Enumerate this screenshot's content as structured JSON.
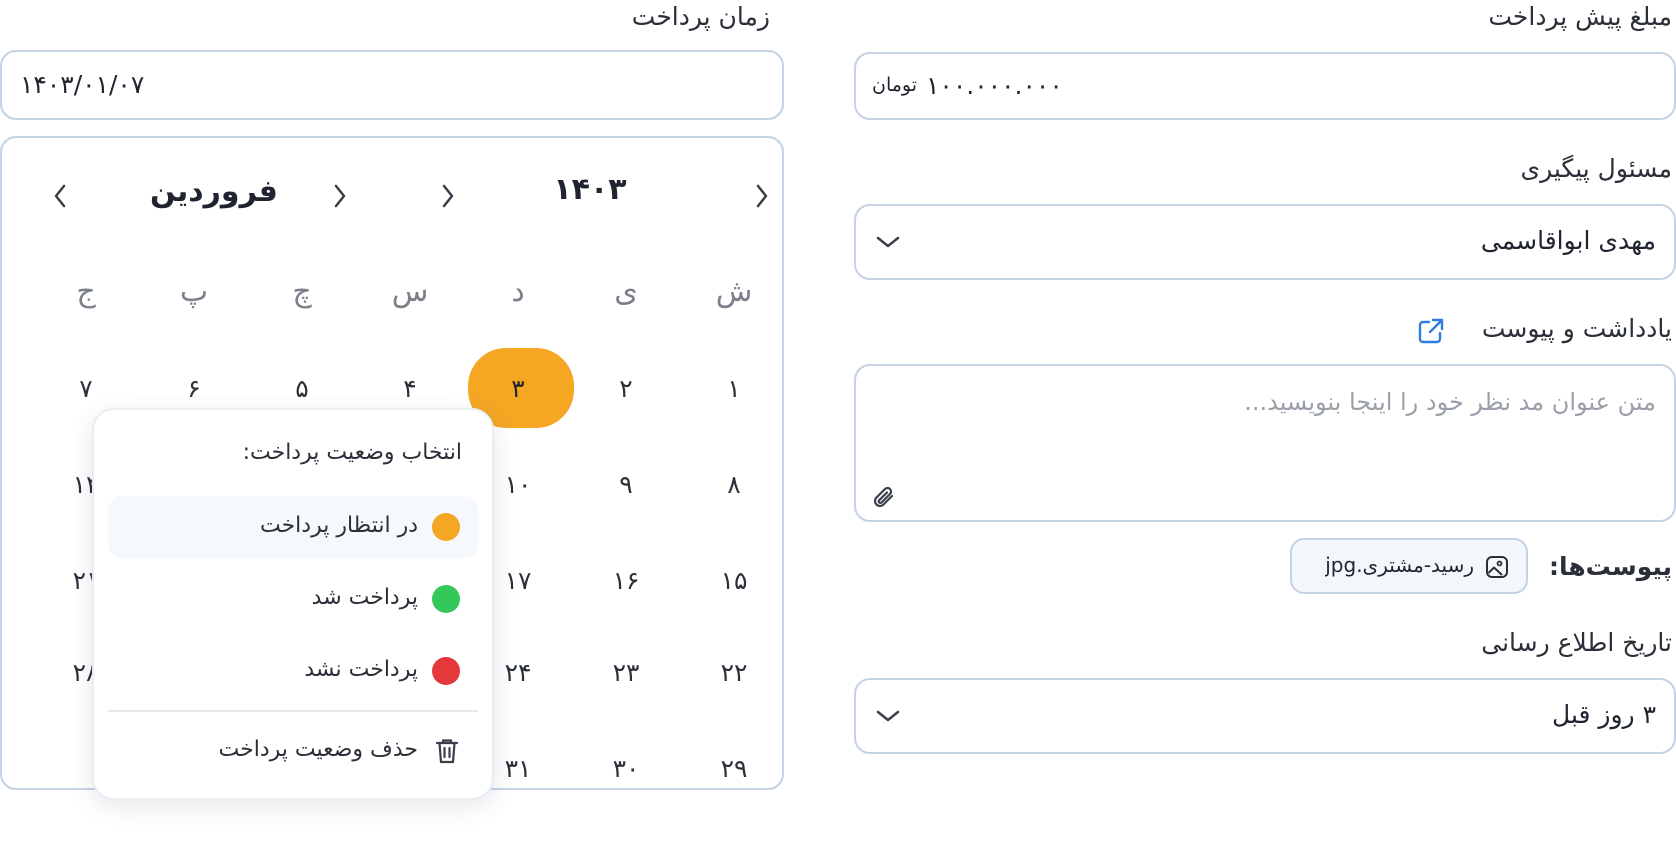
{
  "payment_time": {
    "label": "زمان پرداخت",
    "value": "۱۴۰۳/۰۱/۰۷"
  },
  "prepayment": {
    "label": "مبلغ پیش پرداخت",
    "amount": "۱۰۰.۰۰۰.۰۰۰",
    "currency": "تومان"
  },
  "followup": {
    "label": "مسئول پیگیری",
    "value": "مهدی ابواقاسمی"
  },
  "note": {
    "label": "یادداشت و پیوست",
    "placeholder": "متن عنوان مد نظر خود را اینجا بنویسید..."
  },
  "attachments": {
    "label": "پیوست‌ها:",
    "file_name": "رسید-مشتری.jpg"
  },
  "notify": {
    "label": "تاریخ اطلاع رسانی",
    "value": "۳ روز قبل"
  },
  "calendar": {
    "year": "۱۴۰۳",
    "month": "فروردین",
    "weekdays": [
      "ش",
      "ی",
      "د",
      "س",
      "چ",
      "پ",
      "ج"
    ],
    "selected_day": "۳",
    "selected_color": "#F5A623",
    "rows": [
      [
        "۱",
        "۲",
        "۳",
        "۴",
        "۵",
        "۶",
        "۷"
      ],
      [
        "۸",
        "۹",
        "۱۰",
        "",
        "",
        "",
        "۱۴"
      ],
      [
        "۱۵",
        "۱۶",
        "۱۷",
        "",
        "",
        "",
        "۲۱"
      ],
      [
        "۲۲",
        "۲۳",
        "۲۴",
        "",
        "",
        "",
        "۲۸"
      ],
      [
        "۲۹",
        "۳۰",
        "۳۱",
        "",
        "",
        "",
        ""
      ]
    ]
  },
  "status_menu": {
    "title": "انتخاب وضعیت پرداخت:",
    "options": [
      {
        "label": "در انتظار پرداخت",
        "color": "#F5A623"
      },
      {
        "label": "پرداخت شد",
        "color": "#34C759"
      },
      {
        "label": "پرداخت نشد",
        "color": "#E5383B"
      }
    ],
    "delete_label": "حذف وضعیت پرداخت"
  },
  "icons": {
    "calendar_prev_next": "chevron-icon",
    "external_link": "external-link-icon",
    "paperclip": "paperclip-icon",
    "image_file": "image-icon",
    "trash": "trash-icon",
    "dropdown": "chevron-down-icon"
  }
}
